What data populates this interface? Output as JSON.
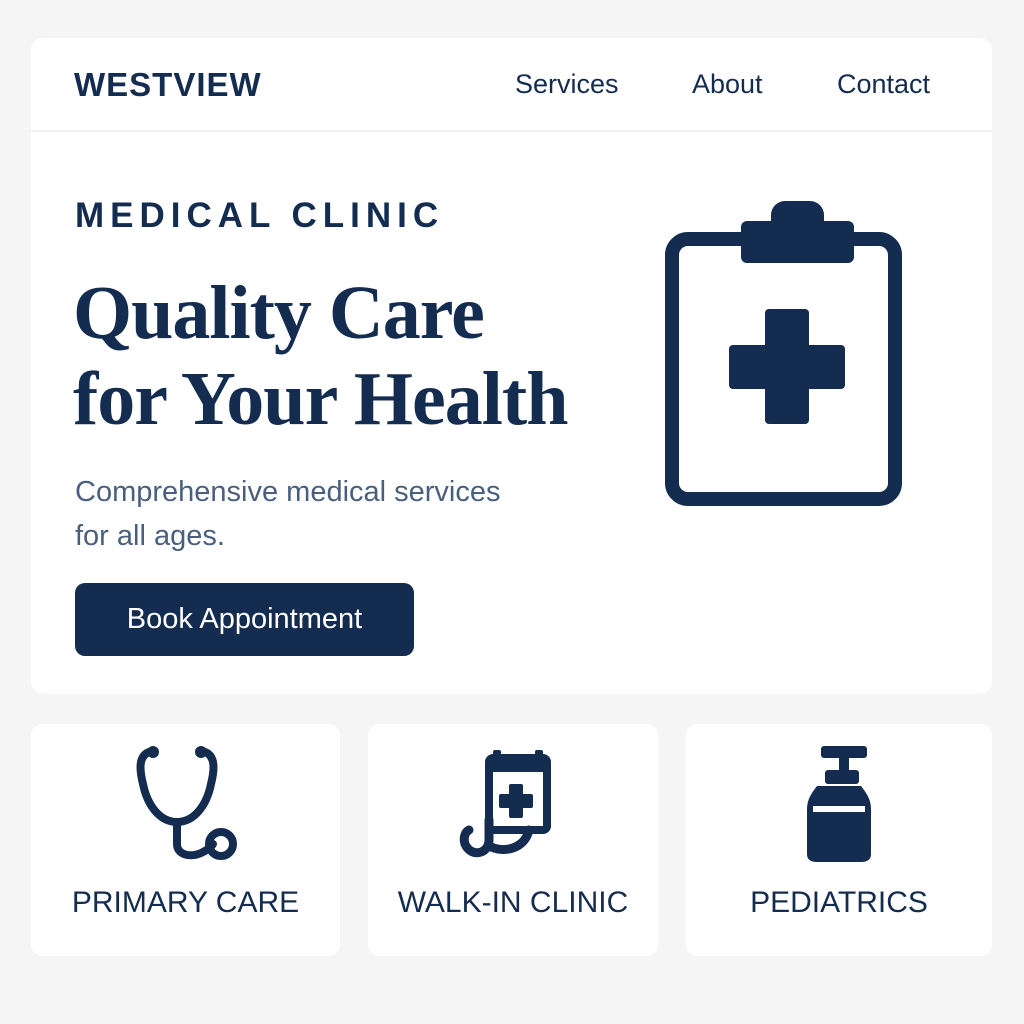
{
  "header": {
    "brand": "WESTVIEW",
    "nav": [
      {
        "label": "Services"
      },
      {
        "label": "About"
      },
      {
        "label": "Contact"
      }
    ]
  },
  "hero": {
    "eyebrow": "MEDICAL CLINIC",
    "headline_line1": "Quality Care",
    "headline_line2": "for Your Health",
    "subtitle_line1": "Comprehensive medical services",
    "subtitle_line2": "for all ages.",
    "cta_label": "Book Appointment",
    "illustration_icon": "clipboard-medical-cross-icon"
  },
  "services": [
    {
      "label": "PRIMARY CARE",
      "icon": "stethoscope-icon"
    },
    {
      "label": "WALK-IN CLINIC",
      "icon": "calendar-medical-icon"
    },
    {
      "label": "PEDIATRICS",
      "icon": "bottle-icon"
    }
  ],
  "colors": {
    "primary": "#142c4f",
    "background": "#f5f5f5",
    "card": "#ffffff",
    "muted_text": "#4a5f7e"
  }
}
